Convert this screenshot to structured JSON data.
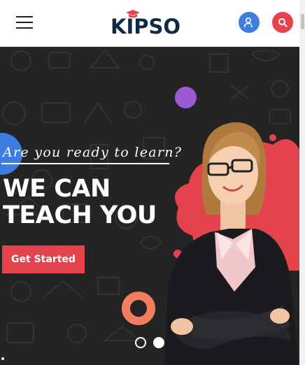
{
  "header": {
    "logo_text": "KIPSO",
    "menu_icon": "hamburger-menu-icon",
    "user_icon": "user-icon",
    "search_icon": "search-icon"
  },
  "hero": {
    "tagline": "Are you ready to learn?",
    "headline_line1": "WE CAN",
    "headline_line2": "TEACH YOU",
    "cta_label": "Get Started",
    "slides": {
      "count": 2,
      "active_index": 1
    }
  },
  "colors": {
    "brand_navy": "#0e2a47",
    "accent_red": "#e4424d",
    "accent_blue": "#3f7ee0",
    "accent_purple": "#9b59d6",
    "accent_orange": "#f47c5f",
    "hero_background": "#242424"
  }
}
